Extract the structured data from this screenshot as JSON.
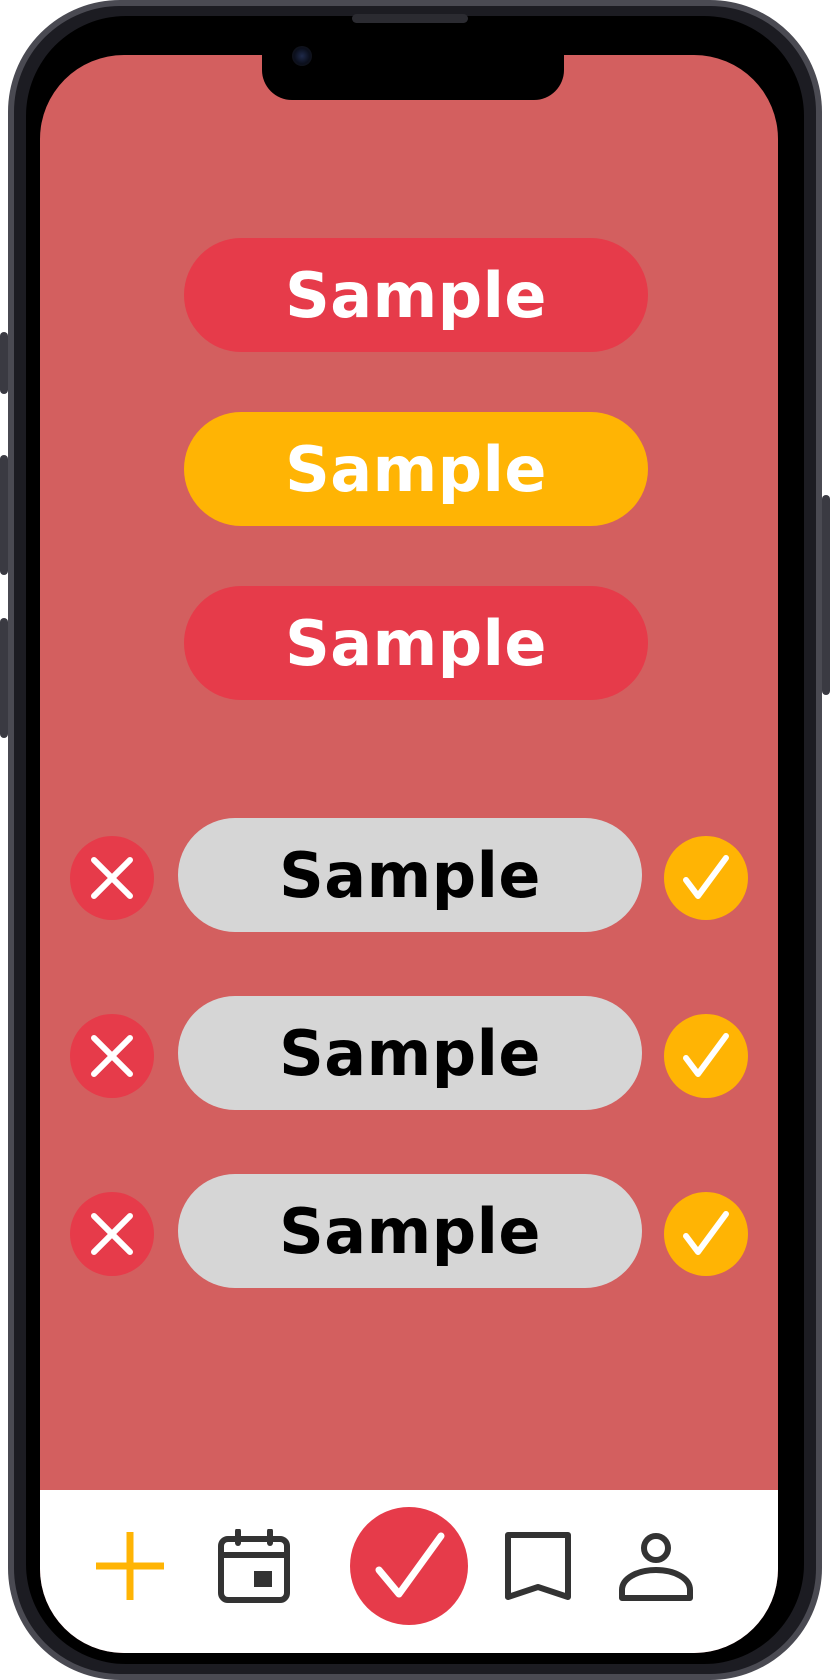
{
  "colors": {
    "screen_background": "#d35f5f",
    "accent_red": "#e63b4a",
    "accent_yellow": "#ffb404",
    "neutral_grey": "#d6d6d6",
    "nav_background": "#ffffff",
    "icon_dark": "#333333"
  },
  "top_buttons": [
    {
      "label": "Sample",
      "color": "red"
    },
    {
      "label": "Sample",
      "color": "yellow"
    },
    {
      "label": "Sample",
      "color": "red"
    }
  ],
  "review_rows": [
    {
      "label": "Sample",
      "reject_icon": "close-icon",
      "accept_icon": "check-icon"
    },
    {
      "label": "Sample",
      "reject_icon": "close-icon",
      "accept_icon": "check-icon"
    },
    {
      "label": "Sample",
      "reject_icon": "close-icon",
      "accept_icon": "check-icon"
    }
  ],
  "bottom_nav": {
    "items": [
      {
        "icon": "plus-icon"
      },
      {
        "icon": "calendar-icon"
      },
      {
        "icon": "check-icon"
      },
      {
        "icon": "bookmark-icon"
      },
      {
        "icon": "profile-icon"
      }
    ]
  }
}
